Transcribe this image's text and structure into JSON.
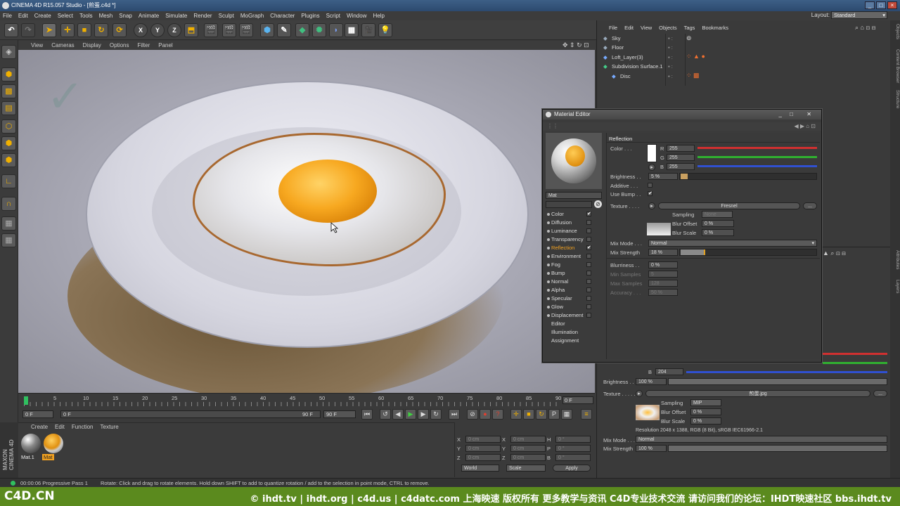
{
  "window": {
    "title": "CINEMA 4D R15.057 Studio - [煎蛋.c4d *]"
  },
  "menubar": [
    "File",
    "Edit",
    "Create",
    "Select",
    "Tools",
    "Mesh",
    "Snap",
    "Animate",
    "Simulate",
    "Render",
    "Sculpt",
    "MoGraph",
    "Character",
    "Plugins",
    "Script",
    "Window",
    "Help"
  ],
  "layout": {
    "label": "Layout:",
    "value": "Standard"
  },
  "viewport": {
    "menu": [
      "View",
      "Cameras",
      "Display",
      "Options",
      "Filter",
      "Panel"
    ]
  },
  "timeline": {
    "ticks": [
      "0",
      "5",
      "10",
      "15",
      "20",
      "25",
      "30",
      "35",
      "40",
      "45",
      "50",
      "55",
      "60",
      "65",
      "70",
      "75",
      "80",
      "85",
      "90"
    ],
    "end_frame": "0 F",
    "start_field": "0 F",
    "current_field": "0 F",
    "max_field": "90 F",
    "max_field2": "90 F"
  },
  "material_manager": {
    "menu": [
      "Create",
      "Edit",
      "Function",
      "Texture"
    ],
    "materials": [
      {
        "name": "Mat.1"
      },
      {
        "name": "Mat"
      }
    ]
  },
  "coords": {
    "rows": [
      {
        "a": "X",
        "av": "0 cm",
        "b": "X",
        "bv": "0 cm",
        "c": "H",
        "cv": "0 °"
      },
      {
        "a": "Y",
        "av": "0 cm",
        "b": "Y",
        "bv": "0 cm",
        "c": "P",
        "cv": "0 °"
      },
      {
        "a": "Z",
        "av": "0 cm",
        "b": "Z",
        "bv": "0 cm",
        "c": "B",
        "cv": "0 °"
      }
    ],
    "world": "World",
    "scale": "Scale",
    "apply": "Apply"
  },
  "status": {
    "time": "00:00:06 Progressive Pass 1",
    "hint": "Rotate: Click and drag to rotate elements. Hold down SHIFT to add to quantize rotation / add to the selection in point mode, CTRL to remove."
  },
  "footer": {
    "left": "C4D.CN",
    "right": "© ihdt.tv | ihdt.org | c4d.us | c4datc.com 上海映速 版权所有 更多教学与资讯 C4D专业技术交流 请访问我们的论坛：IHDT映速社区 bbs.ihdt.tv"
  },
  "object_manager": {
    "menu": [
      "File",
      "Edit",
      "View",
      "Objects",
      "Tags",
      "Bookmarks"
    ],
    "objects": [
      {
        "name": "Sky",
        "indent": 0
      },
      {
        "name": "Floor",
        "indent": 0
      },
      {
        "name": "Loft_Layer(3)",
        "indent": 0
      },
      {
        "name": "Subdivision Surface.1",
        "indent": 0
      },
      {
        "name": "Disc",
        "indent": 1
      }
    ]
  },
  "attributes": {
    "b_label": "B",
    "b_value": "204",
    "brightness_label": "Brightness . .",
    "brightness_value": "100 %",
    "texture_label": "Texture . . . . .",
    "texture_file": "煎蛋.jpg",
    "sampling_label": "Sampling",
    "sampling_value": "MIP",
    "blur_offset_label": "Blur Offset",
    "blur_offset_value": "0 %",
    "blur_scale_label": "Blur Scale",
    "blur_scale_value": "0 %",
    "resolution": "Resolution 2048 x 1388, RGB (8 Bit), sRGB IEC61966-2.1",
    "mix_mode_label": "Mix Mode . . .",
    "mix_mode_value": "Normal",
    "mix_strength_label": "Mix Strength",
    "mix_strength_value": "100 %"
  },
  "side_tabs": [
    "Objects",
    "Content Browser",
    "Structure",
    "Attributes",
    "Layers"
  ],
  "material_editor": {
    "title": "Material Editor",
    "mat_name": "Mat",
    "section": "Reflection",
    "channels": [
      {
        "name": "Color",
        "checked": "✔"
      },
      {
        "name": "Diffusion",
        "checked": ""
      },
      {
        "name": "Luminance",
        "checked": ""
      },
      {
        "name": "Transparency",
        "checked": ""
      },
      {
        "name": "Reflection",
        "checked": "✔"
      },
      {
        "name": "Environment",
        "checked": ""
      },
      {
        "name": "Fog",
        "checked": ""
      },
      {
        "name": "Bump",
        "checked": ""
      },
      {
        "name": "Normal",
        "checked": ""
      },
      {
        "name": "Alpha",
        "checked": ""
      },
      {
        "name": "Specular",
        "checked": ""
      },
      {
        "name": "Glow",
        "checked": ""
      },
      {
        "name": "Displacement",
        "checked": ""
      },
      {
        "name": "Editor",
        "checked": ""
      },
      {
        "name": "Illumination",
        "checked": ""
      },
      {
        "name": "Assignment",
        "checked": ""
      }
    ],
    "color_label": "Color . . .",
    "r_label": "R",
    "r_value": "255",
    "g_label": "G",
    "g_value": "255",
    "b_label": "B",
    "b_value": "255",
    "brightness_label": "Brightness . .",
    "brightness_value": "5 %",
    "additive_label": "Additive . . .",
    "use_bump_label": "Use Bump . .",
    "texture_label": "Texture . . . .",
    "texture_button": "Fresnel",
    "more_button": "...",
    "sampling_label": "Sampling",
    "sampling_value": "None",
    "blur_offset_label": "Blur Offset",
    "blur_offset_value": "0 %",
    "blur_scale_label": "Blur Scale",
    "blur_scale_value": "0 %",
    "mix_mode_label": "Mix Mode . . .",
    "mix_mode_value": "Normal",
    "mix_strength_label": "Mix Strength",
    "mix_strength_value": "18 %",
    "mix_strength_fraction": 0.18,
    "blurriness_label": "Blurriness . .",
    "blurriness_value": "0 %",
    "min_samples_label": "Min Samples",
    "min_samples_value": "5",
    "max_samples_label": "Max Samples",
    "max_samples_value": "128",
    "accuracy_label": "Accuracy . . .",
    "accuracy_value": "50 %"
  },
  "colors": {
    "accent": "#f0a020",
    "footer": "#5b8a1e",
    "red": "#d03030",
    "green": "#30b030",
    "blue": "#3050d0"
  }
}
